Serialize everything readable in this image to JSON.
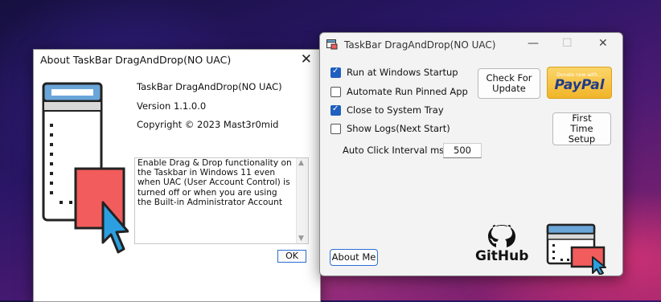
{
  "about": {
    "title": "About TaskBar DragAndDrop(NO UAC)",
    "close_glyph": "✕",
    "app_name": "TaskBar DragAndDrop(NO UAC)",
    "version": "Version 1.1.0.0",
    "copyright": "Copyright © 2023 Mast3r0mid",
    "description": "Enable Drag & Drop functionality on the Taskbar in Windows 11 even when UAC (User Account Control) is turned off or when you are using the Built-in Administrator Account",
    "ok_label": "OK",
    "icon": "app-logo-icon"
  },
  "main": {
    "title": "TaskBar DragAndDrop(NO UAC)",
    "minimize_glyph": "—",
    "maximize_glyph": "☐",
    "close_glyph": "✕",
    "options": [
      {
        "label": "Run at Windows Startup",
        "checked": true
      },
      {
        "label": "Automate Run Pinned App",
        "checked": false
      },
      {
        "label": "Close to System Tray",
        "checked": true
      },
      {
        "label": "Show Logs(Next Start)",
        "checked": false
      }
    ],
    "interval_label": "Auto Click Interval ms",
    "interval_value": "500",
    "check_update_label": "Check For Update",
    "paypal_small": "Donate now with...",
    "paypal_brand": "PayPal",
    "first_time_label": "First Time Setup",
    "about_label": "About Me",
    "github_label": "GitHub"
  },
  "colors": {
    "accent": "#1f5fbf",
    "logo_red": "#f25c5c",
    "logo_blue": "#2b9fe0",
    "paypal_yellow": "#f5c343"
  }
}
